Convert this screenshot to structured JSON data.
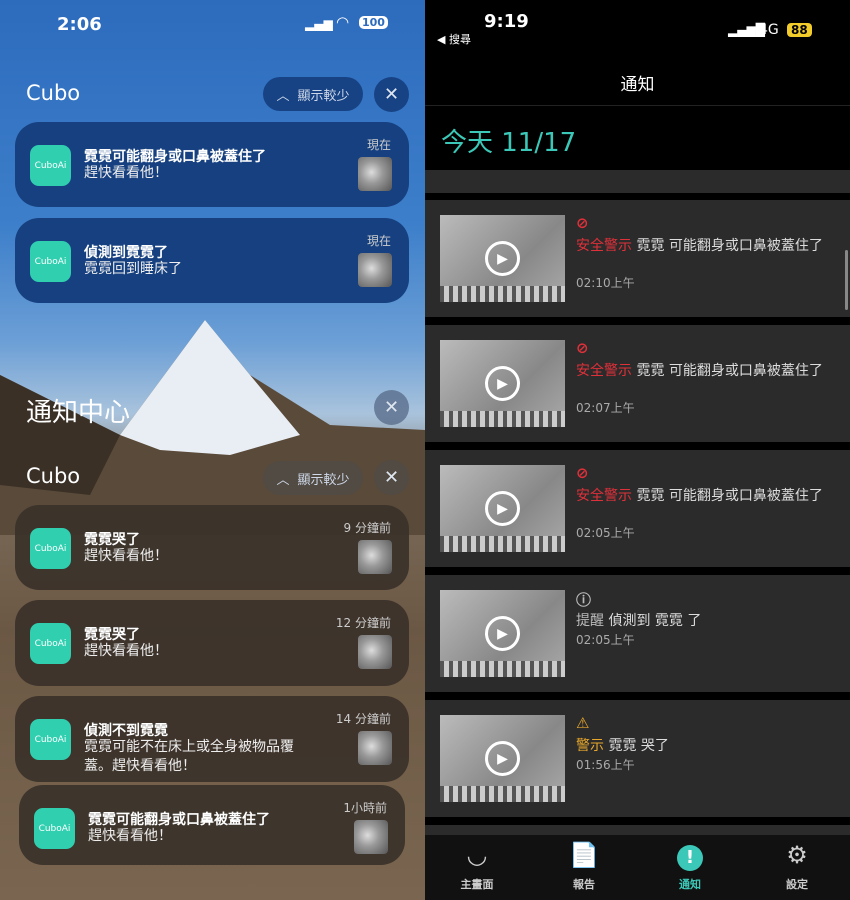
{
  "left": {
    "status": {
      "time": "2:06",
      "battery": "100"
    },
    "group1": {
      "app": "Cubo",
      "show_less": "顯示較少"
    },
    "group1_cards": [
      {
        "title": "霓霓可能翻身或口鼻被蓋住了",
        "body": "趕快看看他！",
        "time": "現在"
      },
      {
        "title": "偵測到霓霓了",
        "body": "霓霓回到睡床了",
        "time": "現在"
      }
    ],
    "notification_center": "通知中心",
    "group2": {
      "app": "Cubo",
      "show_less": "顯示較少"
    },
    "group2_cards": [
      {
        "title": "霓霓哭了",
        "body": "趕快看看他！",
        "time": "9 分鐘前"
      },
      {
        "title": "霓霓哭了",
        "body": "趕快看看他！",
        "time": "12 分鐘前"
      },
      {
        "title": "偵測不到霓霓",
        "body": "霓霓可能不在床上或全身被物品覆蓋。趕快看看他！",
        "time": "14 分鐘前"
      },
      {
        "title": "霓霓可能翻身或口鼻被蓋住了",
        "body": "趕快看看他！",
        "time": "1小時前"
      }
    ],
    "app_icon_label": "CuboAi"
  },
  "right": {
    "status": {
      "time": "9:19",
      "back": "◀ 搜尋",
      "network": "4G",
      "battery": "88"
    },
    "title": "通知",
    "date_header": "今天 11/17",
    "colors": {
      "accent": "#3cc8b8",
      "danger": "#e0303a",
      "warning": "#e8a82a"
    },
    "items": [
      {
        "severity": "danger",
        "icon": "alert-circle-icon",
        "label": "安全警示",
        "text": " 霓霓 可能翻身或口鼻被蓋住了",
        "time": "02:10上午"
      },
      {
        "severity": "danger",
        "icon": "alert-circle-icon",
        "label": "安全警示",
        "text": " 霓霓 可能翻身或口鼻被蓋住了",
        "time": "02:07上午"
      },
      {
        "severity": "danger",
        "icon": "alert-circle-icon",
        "label": "安全警示",
        "text": " 霓霓 可能翻身或口鼻被蓋住了",
        "time": "02:05上午"
      },
      {
        "severity": "info",
        "icon": "info-icon",
        "label": "提醒",
        "text": " 偵測到 霓霓 了",
        "time": "02:05上午"
      },
      {
        "severity": "warning",
        "icon": "warning-icon",
        "label": "警示",
        "text": " 霓霓 哭了",
        "time": "01:56上午"
      }
    ],
    "tabs": [
      {
        "label": "主畫面",
        "active": false
      },
      {
        "label": "報告",
        "active": false
      },
      {
        "label": "通知",
        "active": true
      },
      {
        "label": "設定",
        "active": false
      }
    ]
  }
}
